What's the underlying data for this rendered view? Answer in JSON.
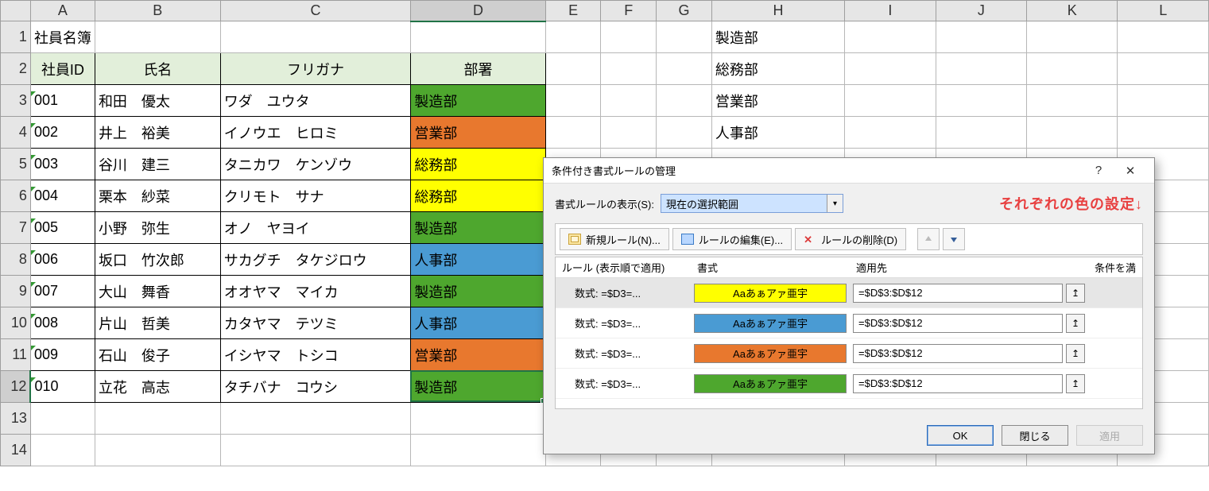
{
  "columns": [
    "A",
    "B",
    "C",
    "D",
    "E",
    "F",
    "G",
    "H",
    "I",
    "J",
    "K",
    "L"
  ],
  "title_cell": "社員名簿",
  "headers": {
    "id": "社員ID",
    "name": "氏名",
    "kana": "フリガナ",
    "dept": "部署"
  },
  "rows": [
    {
      "id": "001",
      "name": "和田　優太",
      "kana": "ワダ　ユウタ",
      "dept": "製造部",
      "color": "green"
    },
    {
      "id": "002",
      "name": "井上　裕美",
      "kana": "イノウエ　ヒロミ",
      "dept": "営業部",
      "color": "orange"
    },
    {
      "id": "003",
      "name": "谷川　建三",
      "kana": "タニカワ　ケンゾウ",
      "dept": "総務部",
      "color": "yellow"
    },
    {
      "id": "004",
      "name": "栗本　紗菜",
      "kana": "クリモト　サナ",
      "dept": "総務部",
      "color": "yellow"
    },
    {
      "id": "005",
      "name": "小野　弥生",
      "kana": "オノ　ヤヨイ",
      "dept": "製造部",
      "color": "green"
    },
    {
      "id": "006",
      "name": "坂口　竹次郎",
      "kana": "サカグチ　タケジロウ",
      "dept": "人事部",
      "color": "blue"
    },
    {
      "id": "007",
      "name": "大山　舞香",
      "kana": "オオヤマ　マイカ",
      "dept": "製造部",
      "color": "green"
    },
    {
      "id": "008",
      "name": "片山　哲美",
      "kana": "カタヤマ　テツミ",
      "dept": "人事部",
      "color": "blue"
    },
    {
      "id": "009",
      "name": "石山　俊子",
      "kana": "イシヤマ　トシコ",
      "dept": "営業部",
      "color": "orange"
    },
    {
      "id": "010",
      "name": "立花　高志",
      "kana": "タチバナ　コウシ",
      "dept": "製造部",
      "color": "green"
    }
  ],
  "dept_list": [
    "製造部",
    "総務部",
    "営業部",
    "人事部"
  ],
  "dialog": {
    "title": "条件付き書式ルールの管理",
    "show_label": "書式ルールの表示(S):",
    "show_value": "現在の選択範囲",
    "annotation": "それぞれの色の設定↓",
    "btn_new": "新規ルール(N)...",
    "btn_edit": "ルールの編集(E)...",
    "btn_delete": "ルールの削除(D)",
    "col_rule": "ルール (表示順で適用)",
    "col_format": "書式",
    "col_target": "適用先",
    "col_stop": "条件を満",
    "rule_text": "数式: =$D3=...",
    "sample": "Aaあぁアァ亜宇",
    "range": "=$D$3:$D$12",
    "rules": [
      {
        "color": "yellow",
        "selected": true
      },
      {
        "color": "blue",
        "selected": false
      },
      {
        "color": "orange",
        "selected": false
      },
      {
        "color": "green",
        "selected": false
      }
    ],
    "ok": "OK",
    "close": "閉じる",
    "apply": "適用",
    "help": "?",
    "x": "✕"
  }
}
